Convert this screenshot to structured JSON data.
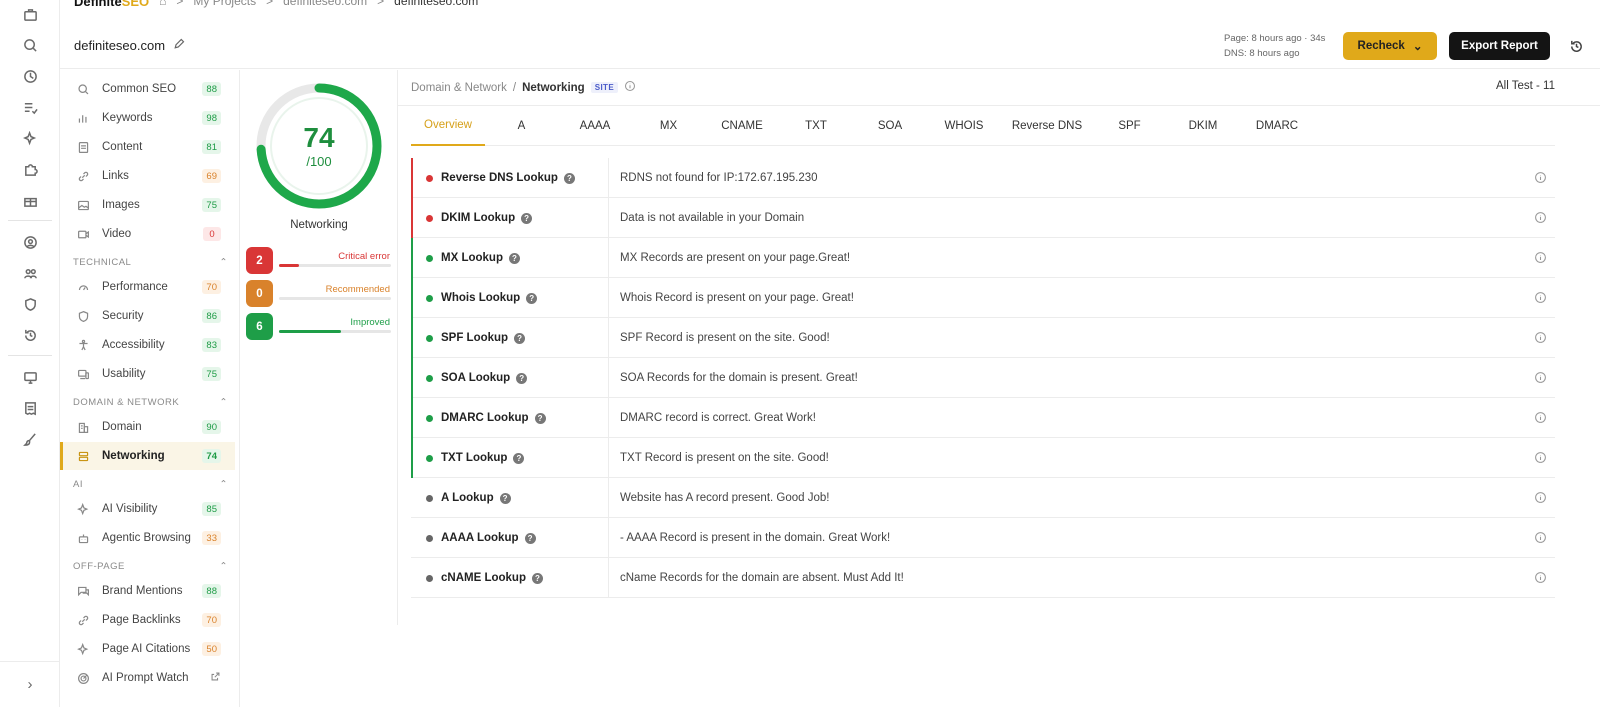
{
  "brand": {
    "name_main": "Definite",
    "name_accent": "SEO"
  },
  "breadcrumbs": {
    "projects": "My Projects",
    "domain": "definiteseo.com",
    "current": "definiteseo.com",
    "sep": ">"
  },
  "header": {
    "domain": "definiteseo.com",
    "page_meta": "Page: 8 hours ago · 34s",
    "dns_meta": "DNS: 8 hours ago",
    "recheck_label": "Recheck",
    "export_label": "Export Report"
  },
  "sidebar": {
    "items_top": [
      {
        "label": "Common SEO",
        "score": "88",
        "color": "green",
        "icon": "search-icon"
      },
      {
        "label": "Keywords",
        "score": "98",
        "color": "green",
        "icon": "bar-chart-icon"
      },
      {
        "label": "Content",
        "score": "81",
        "color": "green",
        "icon": "document-icon"
      },
      {
        "label": "Links",
        "score": "69",
        "color": "orange",
        "icon": "link-icon"
      },
      {
        "label": "Images",
        "score": "75",
        "color": "green",
        "icon": "image-icon"
      },
      {
        "label": "Video",
        "score": "0",
        "color": "red",
        "icon": "video-icon"
      }
    ],
    "section_technical": "TECHNICAL",
    "items_technical": [
      {
        "label": "Performance",
        "score": "70",
        "color": "orange",
        "icon": "gauge-icon"
      },
      {
        "label": "Security",
        "score": "86",
        "color": "green",
        "icon": "shield-icon"
      },
      {
        "label": "Accessibility",
        "score": "83",
        "color": "green",
        "icon": "accessibility-icon"
      },
      {
        "label": "Usability",
        "score": "75",
        "color": "green",
        "icon": "devices-icon"
      }
    ],
    "section_domain": "DOMAIN & NETWORK",
    "items_domain": [
      {
        "label": "Domain",
        "score": "90",
        "color": "green",
        "icon": "building-icon"
      },
      {
        "label": "Networking",
        "score": "74",
        "color": "green",
        "icon": "server-icon"
      }
    ],
    "section_ai": "AI",
    "items_ai": [
      {
        "label": "AI Visibility",
        "score": "85",
        "color": "green",
        "icon": "sparkle-icon"
      },
      {
        "label": "Agentic Browsing",
        "score": "33",
        "color": "orange",
        "icon": "robot-icon"
      }
    ],
    "section_offpage": "OFF-PAGE",
    "items_offpage": [
      {
        "label": "Brand Mentions",
        "score": "88",
        "color": "green",
        "icon": "chat-icon"
      },
      {
        "label": "Page Backlinks",
        "score": "70",
        "color": "orange",
        "icon": "link-icon"
      },
      {
        "label": "Page AI Citations",
        "score": "50",
        "color": "orange",
        "icon": "sparkle-icon"
      },
      {
        "label": "AI Prompt Watch",
        "icon": "radar-icon"
      }
    ]
  },
  "score": {
    "value": "74",
    "max": "/100",
    "fraction": 0.74,
    "label": "Networking",
    "stats": [
      {
        "count": "2",
        "label": "Critical error",
        "color": "#d93636",
        "fill": 0.18
      },
      {
        "count": "0",
        "label": "Recommended",
        "color": "#d9822b",
        "fill": 0.0
      },
      {
        "count": "6",
        "label": "Improved",
        "color": "#1e9e48",
        "fill": 0.55
      }
    ]
  },
  "main": {
    "crumb_parent": "Domain & Network",
    "crumb_sep": "/",
    "crumb_current": "Networking",
    "site_tag": "SITE",
    "all_test": "All Test - 11",
    "tabs": [
      "Overview",
      "A",
      "AAAA",
      "MX",
      "CNAME",
      "TXT",
      "SOA",
      "WHOIS",
      "Reverse DNS",
      "SPF",
      "DKIM",
      "DMARC"
    ],
    "rows": [
      {
        "name": "Reverse DNS Lookup",
        "desc": "RDNS not found for IP:172.67.195.230",
        "status": "red"
      },
      {
        "name": "DKIM Lookup",
        "desc": "Data is not available in your Domain",
        "status": "red"
      },
      {
        "name": "MX Lookup",
        "desc": "MX Records are present on your page.Great!",
        "status": "green"
      },
      {
        "name": "Whois Lookup",
        "desc": "Whois Record is present on your page. Great!",
        "status": "green"
      },
      {
        "name": "SPF Lookup",
        "desc": "SPF Record is present on the site. Good!",
        "status": "green"
      },
      {
        "name": "SOA Lookup",
        "desc": "SOA Records for the domain is present. Great!",
        "status": "green"
      },
      {
        "name": "DMARC Lookup",
        "desc": "DMARC record is correct. Great Work!",
        "status": "green"
      },
      {
        "name": "TXT Lookup",
        "desc": "TXT Record is present on the site. Good!",
        "status": "green"
      },
      {
        "name": "A Lookup",
        "desc": "Website has A record present. Good Job!",
        "status": "gray"
      },
      {
        "name": "AAAA Lookup",
        "desc": "- AAAA Record is present in the domain. Great Work!",
        "status": "gray"
      },
      {
        "name": "cNAME Lookup",
        "desc": "cName Records for the domain are absent. Must Add It!",
        "status": "gray"
      }
    ]
  },
  "colors": {
    "accent": "#e0a91a",
    "green": "#1e9e48",
    "red": "#d93636",
    "orange": "#d9822b",
    "gray": "#666666"
  }
}
